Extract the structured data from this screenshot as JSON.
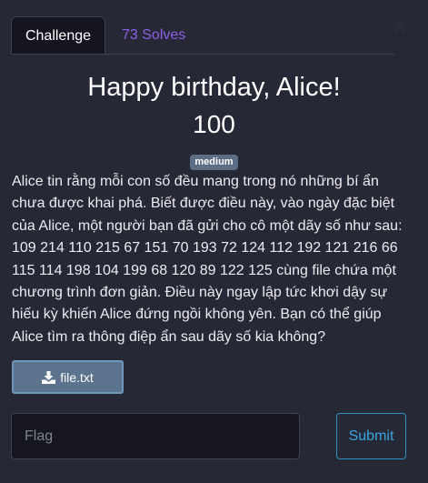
{
  "tabs": [
    {
      "label": "Challenge",
      "active": true
    },
    {
      "label": "73 Solves",
      "active": false
    }
  ],
  "challenge": {
    "title": "Happy birthday, Alice!",
    "points": "100",
    "difficulty": "medium",
    "description": "Alice tin rằng mỗi con số đều mang trong nó những bí ẩn chưa được khai phá. Biết được điều này, vào ngày đặc biệt của Alice, một người bạn đã gửi cho cô một dãy số như sau: 109 214 110 215 67 151 70 193 72 124 112 192 121 216 66 115 114 198 104 199 68 120 89 122 125 cùng file chứa một chương trình đơn giản. Điều này ngay lập tức khơi dậy sự hiếu kỳ khiến Alice đứng ngồi không yên. Bạn có thể giúp Alice tìm ra thông điệp ẩn sau dãy số kia không?",
    "file_label": "file.txt"
  },
  "form": {
    "flag_placeholder": "Flag",
    "flag_value": "",
    "submit_label": "Submit"
  },
  "icons": {
    "close": "close-icon",
    "download": "download-icon"
  },
  "colors": {
    "background": "#272835",
    "solves_link": "#8b60e8",
    "badge": "#5d6d85",
    "file_button": "#5c738d",
    "submit_accent": "#3ba7e0"
  }
}
